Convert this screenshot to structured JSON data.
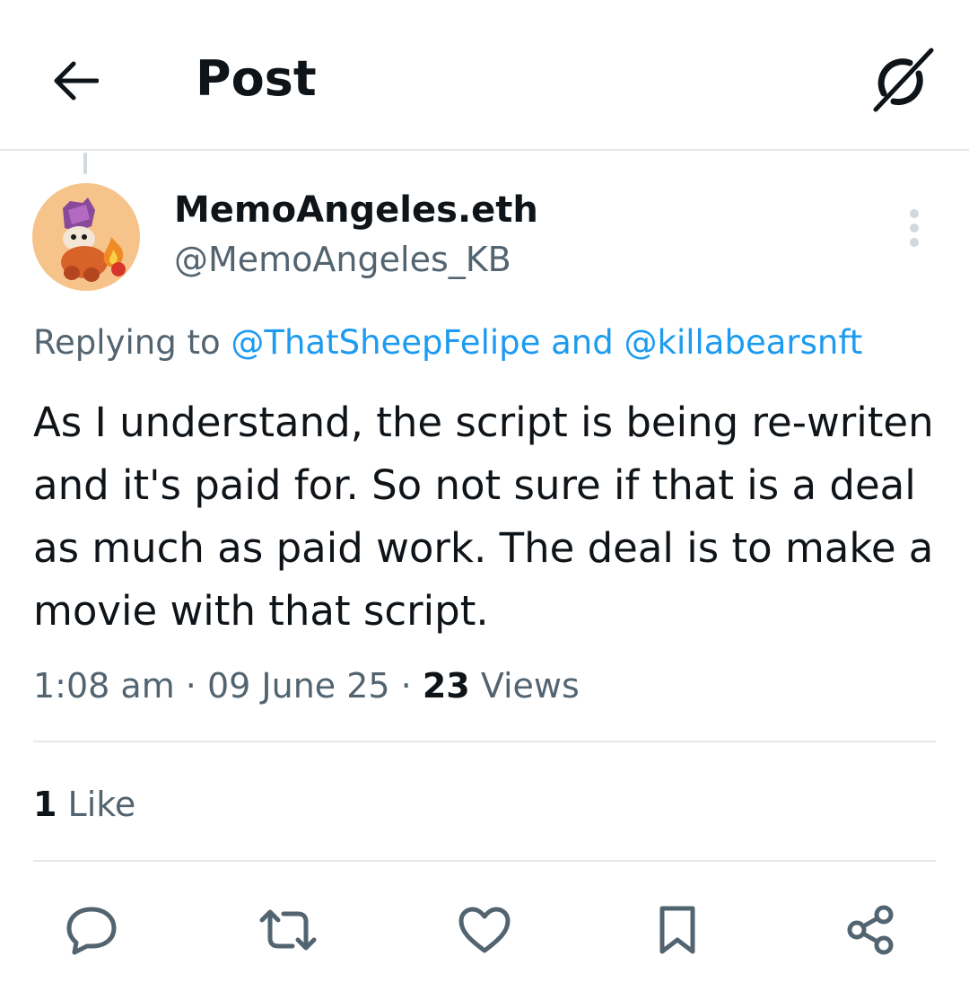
{
  "header": {
    "title": "Post",
    "back_icon": "arrow-left-icon",
    "grok_icon": "grok-icon"
  },
  "author": {
    "display_name": "MemoAngeles.eth",
    "handle": "@MemoAngeles_KB",
    "avatar_icon": "avatar-image",
    "more_icon": "more-vertical-icon"
  },
  "reply": {
    "prefix": "Replying to ",
    "mention1": "@ThatSheepFelipe",
    "joiner": " and ",
    "mention2": "@killabearsnft"
  },
  "post": {
    "text": "As I understand, the script is being re-writen and it's paid for. So not sure if that is a deal as much as paid work. The deal is to make a movie with that script."
  },
  "meta": {
    "time": "1:08 am",
    "sep1": " · ",
    "date": "09 June 25",
    "sep2": " · ",
    "views_count": "23",
    "views_label": " Views"
  },
  "stats": {
    "likes_count": "1",
    "likes_label": " Like"
  },
  "actions": [
    {
      "icon": "reply-icon"
    },
    {
      "icon": "repost-icon"
    },
    {
      "icon": "like-heart-icon"
    },
    {
      "icon": "bookmark-icon"
    },
    {
      "icon": "share-icon"
    }
  ],
  "colors": {
    "text": "#0f1419",
    "secondary": "#536471",
    "link": "#1d9bf0",
    "divider": "#e3e8eb"
  }
}
